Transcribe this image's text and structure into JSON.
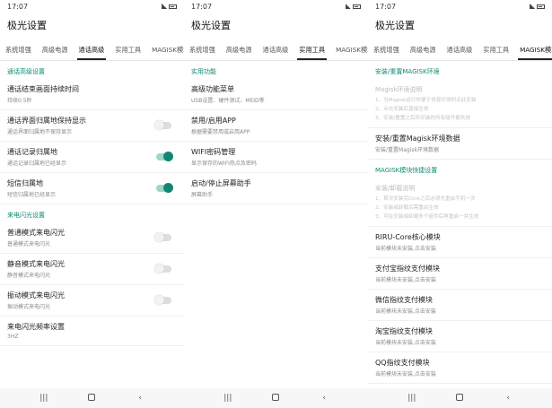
{
  "status_time": "17:07",
  "app_title": "极光设置",
  "tabs": [
    "系统增强",
    "高级电源",
    "通话高级",
    "实用工具",
    "MAGISK模块"
  ],
  "screen1": {
    "section1": "通话高级设置",
    "section1_items": [
      {
        "title": "通话结束画面持续时间",
        "sub": "持续0.5秒",
        "toggle": null
      },
      {
        "title": "通话界面归属地保持显示",
        "sub": "通话界面归属地不保持显示",
        "toggle": false
      },
      {
        "title": "通话记录归属地",
        "sub": "通话记录归属地已经显示",
        "toggle": true
      },
      {
        "title": "短信归属地",
        "sub": "短信归属地已经显示",
        "toggle": true
      }
    ],
    "section2": "来电闪光设置",
    "section2_items": [
      {
        "title": "普通模式来电闪光",
        "sub": "普通模式来电闪光",
        "toggle": false
      },
      {
        "title": "静音模式来电闪光",
        "sub": "静音模式来电闪光",
        "toggle": false
      },
      {
        "title": "振动模式来电闪光",
        "sub": "振动模式来电闪光",
        "toggle": false
      },
      {
        "title": "来电闪光频率设置",
        "sub": "3HZ",
        "toggle": null
      }
    ]
  },
  "screen2": {
    "section1": "实用功能",
    "items": [
      {
        "title": "高级功能菜单",
        "sub": "USB设置、硬件测试、MEID等"
      },
      {
        "title": "禁用/启用APP",
        "sub": "根据需要禁用或启用APP"
      },
      {
        "title": "WIFI密码管理",
        "sub": "显示保存的WIFI热点及密码"
      },
      {
        "title": "启动/停止屏幕助手",
        "sub": "屏幕助手"
      }
    ]
  },
  "screen3": {
    "section1": "安装/重置MAGISK环境",
    "desc1_title": "Magisk环境说明",
    "desc1_lines": [
      "1、当Magisk运行时便于修复环境时点此安装",
      "2、点击安装后直接生效",
      "3、安装/重置之后所安装的所有组件都失效"
    ],
    "item1": {
      "title": "安装/重置Magisk环境数据",
      "sub": "安装/重置Magisk环境数据"
    },
    "section2": "MAGISK模块快捷设置",
    "desc2_title": "安装/卸载说明",
    "desc2_lines": [
      "1、首次安装完Core之后必须先重启手机一次",
      "2、安装或卸载后需重启生效",
      "3、可在安装或卸载多个组件后再重启一并生效"
    ],
    "modules": [
      {
        "title": "RIRU-Core核心模块",
        "sub": "当前模块未安装,点击安装"
      },
      {
        "title": "支付宝指纹支付模块",
        "sub": "当前模块未安装,点击安装"
      },
      {
        "title": "微信指纹支付模块",
        "sub": "当前模块未安装,点击安装"
      },
      {
        "title": "淘宝指纹支付模块",
        "sub": "当前模块未安装,点击安装"
      },
      {
        "title": "QQ指纹支付模块",
        "sub": "当前模块未安装,点击安装"
      }
    ]
  },
  "colors": {
    "accent": "#0f8a73",
    "toggle_on": "#12876f"
  }
}
